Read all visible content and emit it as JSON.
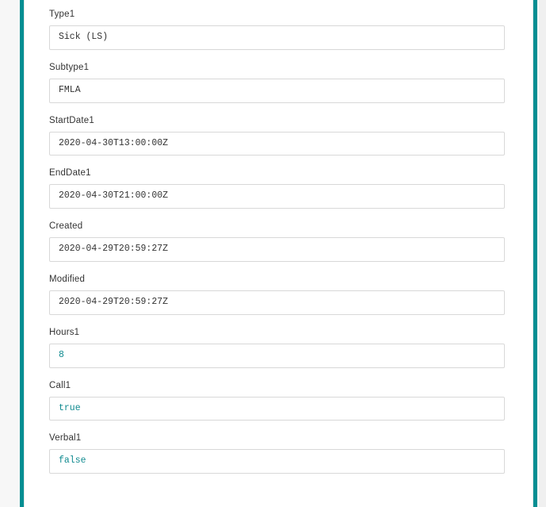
{
  "fields": [
    {
      "label": "Type1",
      "value": "Sick (LS)",
      "valueType": "string"
    },
    {
      "label": "Subtype1",
      "value": "FMLA",
      "valueType": "string"
    },
    {
      "label": "StartDate1",
      "value": "2020-04-30T13:00:00Z",
      "valueType": "string"
    },
    {
      "label": "EndDate1",
      "value": "2020-04-30T21:00:00Z",
      "valueType": "string"
    },
    {
      "label": "Created",
      "value": "2020-04-29T20:59:27Z",
      "valueType": "string"
    },
    {
      "label": "Modified",
      "value": "2020-04-29T20:59:27Z",
      "valueType": "string"
    },
    {
      "label": "Hours1",
      "value": "8",
      "valueType": "number"
    },
    {
      "label": "Call1",
      "value": "true",
      "valueType": "boolean"
    },
    {
      "label": "Verbal1",
      "value": "false",
      "valueType": "boolean"
    }
  ]
}
